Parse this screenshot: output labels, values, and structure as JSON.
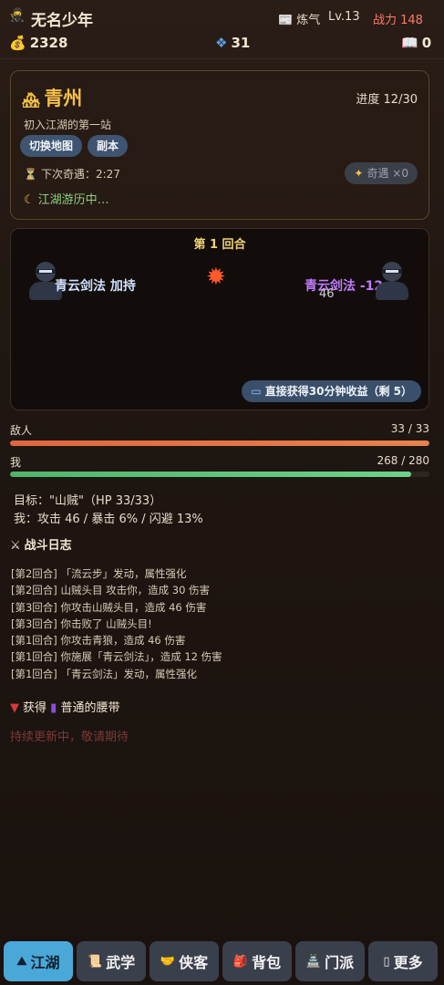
{
  "header": {
    "player_name": "无名少年",
    "realm": "炼气",
    "level": "Lv.13",
    "power_label": "战力 148",
    "gold": "2328",
    "gems": "31",
    "books": "0"
  },
  "location": {
    "title": "青州",
    "progress": "进度 12/30",
    "description": "初入江湖的第一站",
    "switch_map_label": "切换地图",
    "dungeon_label": "副本",
    "next_encounter": "下次奇遇：2:27",
    "encounter_chip": "奇遇 ×0",
    "status": "江湖游历中…"
  },
  "battle": {
    "round": "第 1 回合",
    "left_skill": "青云剑法 加持",
    "right_skill": "青云剑法 -12",
    "damage": "46",
    "instant_reward": "直接获得30分钟收益（剩 5）"
  },
  "hp": {
    "enemy_label": "敌人",
    "enemy_value": "33 / 33",
    "enemy_fraction": 1.0,
    "self_label": "我",
    "self_value": "268 / 280",
    "self_fraction": 0.957
  },
  "target": {
    "line1": "目标：\"山贼\"（HP 33/33）",
    "line2": "我：攻击 46 / 暴击 6% / 闪避 13%"
  },
  "combat_log": {
    "title": "战斗日志",
    "entries": [
      "[第2回合] 「流云步」发动，属性强化",
      "[第2回合] 山贼头目 攻击你，造成 30 伤害",
      "[第3回合] 你攻击山贼头目，造成 46 伤害",
      "[第3回合] 你击败了 山贼头目!",
      "[第1回合] 你攻击青狼，造成 46 伤害",
      "[第1回合] 你施展「青云剑法」，造成 12 伤害",
      "[第1回合] 「青云剑法」发动，属性强化"
    ]
  },
  "loot": {
    "prefix": "获得",
    "item": "普通的腰带"
  },
  "update_notice": "持续更新中，敬请期待",
  "nav": [
    {
      "label": "江湖",
      "icon": "mountain-icon"
    },
    {
      "label": "武学",
      "icon": "scroll-icon"
    },
    {
      "label": "侠客",
      "icon": "handshake-icon"
    },
    {
      "label": "背包",
      "icon": "bag-icon"
    },
    {
      "label": "门派",
      "icon": "pagoda-icon"
    },
    {
      "label": "更多",
      "icon": "more-icon"
    }
  ],
  "colors": {
    "accent_gold": "#f5c04a",
    "enemy_bar": "#e0663e",
    "self_bar": "#5ec47a",
    "nav_active": "#4aa8d8",
    "power": "#ff7b6b"
  }
}
